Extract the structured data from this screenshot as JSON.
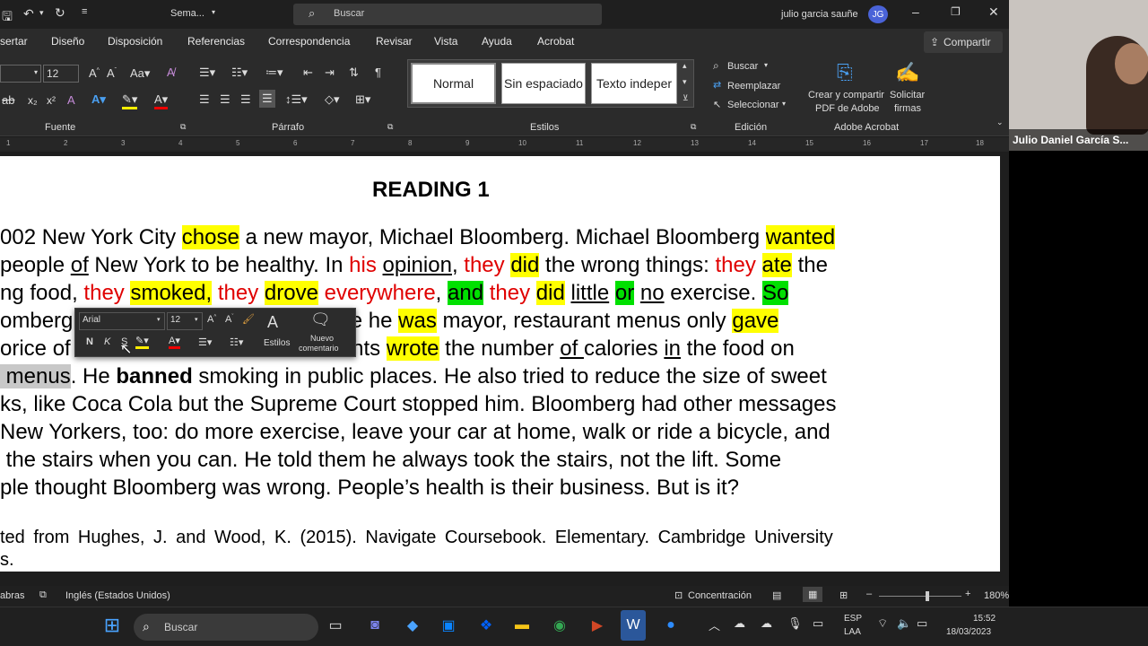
{
  "titlebar": {
    "doc_name": "Sema...",
    "search_placeholder": "Buscar",
    "user_name": "julio garcia sauñe",
    "user_initials": "JG"
  },
  "tabs": [
    "sertar",
    "Diseño",
    "Disposición",
    "Referencias",
    "Correspondencia",
    "Revisar",
    "Vista",
    "Ayuda",
    "Acrobat"
  ],
  "share_label": "Compartir",
  "ribbon": {
    "font_size": "12",
    "styles": [
      "Normal",
      "Sin espaciado",
      "Texto indeper"
    ],
    "group_labels": {
      "fuente": "Fuente",
      "parrafo": "Párrafo",
      "estilos": "Estilos",
      "edicion": "Edición",
      "adobe": "Adobe Acrobat"
    },
    "edit_buscar": "Buscar",
    "edit_reemplazar": "Reemplazar",
    "edit_seleccionar": "Seleccionar",
    "adobe_create": "Crear y compartir",
    "adobe_pdf": "PDF de Adobe",
    "adobe_request": "Solicitar",
    "adobe_sign": "firmas"
  },
  "ruler_numbers": [
    "1",
    "1",
    "2",
    "3",
    "4",
    "5",
    "6",
    "7",
    "8",
    "9",
    "10",
    "11",
    "12",
    "13",
    "14",
    "15",
    "16",
    "17",
    "18"
  ],
  "video": {
    "participant": "Julio Daniel García S..."
  },
  "document": {
    "heading": "READING 1",
    "citation_l1": "ted from Hughes, J. and Wood, K. (2015). Navigate Coursebook. Elementary. Cambridge University",
    "citation_l2": "s."
  },
  "mini_toolbar": {
    "font": "Arial",
    "size": "12",
    "styles_label": "Estilos",
    "new_comment_l1": "Nuevo",
    "new_comment_l2": "comentario",
    "bold": "N",
    "italic": "K",
    "underline": "S"
  },
  "statusbar": {
    "words": "abras",
    "language": "Inglés (Estados Unidos)",
    "focus": "Concentración",
    "zoom": "180%"
  },
  "taskbar": {
    "search_placeholder": "Buscar",
    "lang_l1": "ESP",
    "lang_l2": "LAA",
    "time": "15:52",
    "date": "18/03/2023"
  }
}
